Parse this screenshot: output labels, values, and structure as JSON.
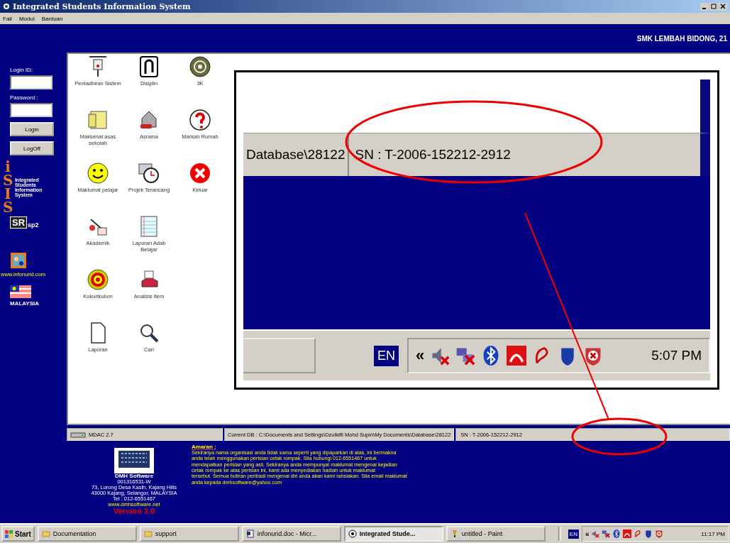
{
  "window": {
    "title": "Integrated Students Information System"
  },
  "menu": [
    "Fail",
    "Modul",
    "Bantuan"
  ],
  "header": {
    "school": "SMK LEMBAH BIDONG, 21"
  },
  "sidebar": {
    "login_label": "Login ID:",
    "password_label": "Password :",
    "buttons": [
      "Login",
      "LogOff"
    ],
    "logo_letters": "iSIS",
    "logo_caption": "Integrated Students Information System",
    "sr_badge": "SR",
    "sr_version": "sp2",
    "website": "www.infonurid.com",
    "country": "MALAYSIA"
  },
  "modules": [
    [
      {
        "label": "Pentadbiran Sistem",
        "kind": "lamp"
      },
      {
        "label": "Disiplin",
        "kind": "uturn"
      },
      {
        "label": "3K",
        "kind": "wheel"
      }
    ],
    [
      {
        "label": "Maklumat asas sekolah",
        "kind": "folder"
      },
      {
        "label": "Asrama",
        "kind": "house"
      },
      {
        "label": "Markah Rumah",
        "kind": "question"
      }
    ],
    [
      {
        "label": "Maklumat pelajar",
        "kind": "smiley"
      },
      {
        "label": "Projek Terancang",
        "kind": "clock"
      },
      {
        "label": "Keluar",
        "kind": "exit"
      }
    ],
    [
      {
        "label": "Akademik",
        "kind": "pen"
      },
      {
        "label": "Laporan Adab Belajar",
        "kind": "notebook"
      }
    ],
    [
      {
        "label": "Kokurikulum",
        "kind": "target"
      },
      {
        "label": "Analisis Item",
        "kind": "printer"
      }
    ],
    [
      {
        "label": "Laporan",
        "kind": "document"
      },
      {
        "label": "Cari",
        "kind": "search"
      }
    ]
  ],
  "callout": {
    "path_text": "Database\\28122",
    "serial": "SN : T-2006-152212-2912",
    "language": "EN",
    "chevron": "«",
    "time": "5:07 PM"
  },
  "status_bar": [
    "MDAC 2.7",
    "Current DB : C:\\Documents and Settings\\Dzulkifli Mohd Supin\\My Documents\\Database\\28122",
    "SN : T-2006-152212-2912"
  ],
  "vendor": {
    "name": "DMH Software",
    "lines": [
      "001316531-W",
      "73, Lorong Desa Kasih, Kajang Hills",
      "43000 Kajang, Selangor, MALAYSIA",
      "Tel : 012-6551467"
    ],
    "website": "www.dmhsoftware.net",
    "version": "Version 3.0"
  },
  "warning": {
    "title": "Amaran :",
    "lines": [
      "Sekiranya nama organisasi anda tidak sama seperti yang dipaparkan di atas, ini bermakna",
      "anda telah menggunakan perisian cetak rompak. Sila hubungi 012-6551467 untuk",
      "mendapatkan perisian yang asli. Sekiranya anda mempunyai maklumat mengenai kejadian",
      "cetak rompak ke atas perisian ini, kami ada menyediakan hadiah untuk maklumat",
      "tersebut. Semua butiran peribadi mengenai diri anda akan kami rahsiakan. Sila email maklumat",
      "anda kepada dmhsoftware@yahoo.com"
    ]
  },
  "taskbar": {
    "start": "Start",
    "tasks": [
      {
        "label": "Documentation",
        "kind": "folder",
        "selected": false
      },
      {
        "label": "support",
        "kind": "folder",
        "selected": false
      },
      {
        "label": "infonurid.doc - Micr...",
        "kind": "doc",
        "selected": false
      },
      {
        "label": "Integrated Stude...",
        "kind": "app",
        "selected": true
      },
      {
        "label": "untitled - Paint",
        "kind": "paint",
        "selected": false
      }
    ],
    "language": "EN",
    "chevron": "«",
    "time": "11:17 PM"
  }
}
